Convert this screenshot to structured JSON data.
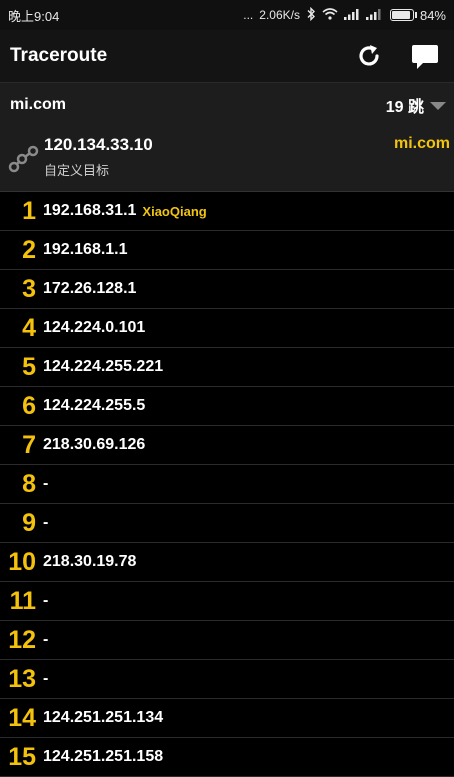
{
  "status_bar": {
    "time": "晚上9:04",
    "dots": "...",
    "net_speed": "2.06K/s",
    "bluetooth_icon": "bluetooth-icon",
    "wifi_icon": "wifi-icon",
    "signal1_icon": "signal-icon",
    "signal2_icon": "signal-icon",
    "battery": "84%"
  },
  "toolbar": {
    "title": "Traceroute",
    "refresh_icon": "refresh-icon",
    "chat_icon": "chat-icon"
  },
  "target": {
    "host": "mi.com",
    "hops_label": "19 跳",
    "ip": "120.134.33.10",
    "subtitle": "自定义目标",
    "dest_name": "mi.com"
  },
  "hops": [
    {
      "num": "1",
      "ip": "192.168.31.1",
      "host": "XiaoQiang"
    },
    {
      "num": "2",
      "ip": "192.168.1.1",
      "host": ""
    },
    {
      "num": "3",
      "ip": "172.26.128.1",
      "host": ""
    },
    {
      "num": "4",
      "ip": "124.224.0.101",
      "host": ""
    },
    {
      "num": "5",
      "ip": "124.224.255.221",
      "host": ""
    },
    {
      "num": "6",
      "ip": "124.224.255.5",
      "host": ""
    },
    {
      "num": "7",
      "ip": "218.30.69.126",
      "host": ""
    },
    {
      "num": "8",
      "ip": "-",
      "host": ""
    },
    {
      "num": "9",
      "ip": "-",
      "host": ""
    },
    {
      "num": "10",
      "ip": "218.30.19.78",
      "host": ""
    },
    {
      "num": "11",
      "ip": "-",
      "host": ""
    },
    {
      "num": "12",
      "ip": "-",
      "host": ""
    },
    {
      "num": "13",
      "ip": "-",
      "host": ""
    },
    {
      "num": "14",
      "ip": "124.251.251.134",
      "host": ""
    },
    {
      "num": "15",
      "ip": "124.251.251.158",
      "host": ""
    }
  ]
}
